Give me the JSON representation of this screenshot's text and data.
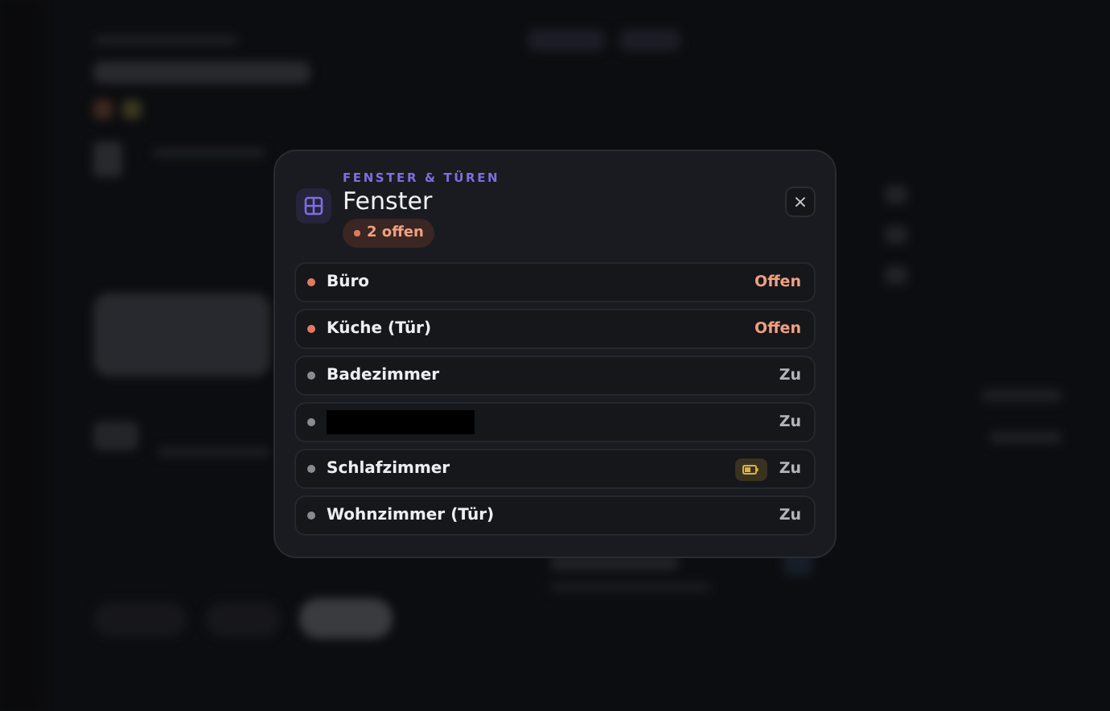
{
  "dialog": {
    "eyebrow": "FENSTER & TÜREN",
    "title": "Fenster",
    "badge": "2 offen",
    "close": "×",
    "items": [
      {
        "name": "Büro",
        "status": "Offen",
        "open": true,
        "redacted": false,
        "low_battery": false
      },
      {
        "name": "Küche (Tür)",
        "status": "Offen",
        "open": true,
        "redacted": false,
        "low_battery": false
      },
      {
        "name": "Badezimmer",
        "status": "Zu",
        "open": false,
        "redacted": false,
        "low_battery": false
      },
      {
        "status": "Zu",
        "open": false,
        "redacted": true,
        "low_battery": false
      },
      {
        "name": "Schlafzimmer",
        "status": "Zu",
        "open": false,
        "redacted": false,
        "low_battery": true
      },
      {
        "name": "Wohnzimmer (Tür)",
        "status": "Zu",
        "open": false,
        "redacted": false,
        "low_battery": false
      }
    ]
  }
}
